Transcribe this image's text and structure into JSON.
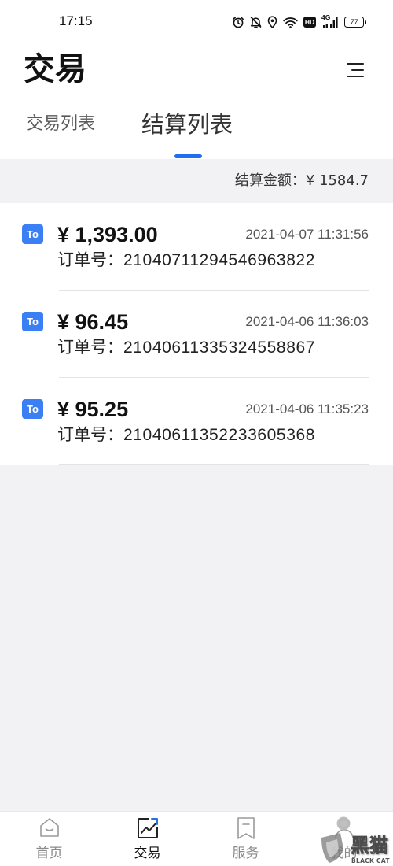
{
  "status_bar": {
    "time": "17:15",
    "icons": [
      "alarm-clock-icon",
      "bell-off-icon",
      "location-icon",
      "wifi-icon",
      "hd-badge",
      "signal-icon",
      "battery-icon"
    ],
    "hd_label": "HD",
    "network_label": "4G",
    "battery_level": "77"
  },
  "header": {
    "title": "交易",
    "menu_icon": "menu-icon"
  },
  "tabs": [
    {
      "label": "交易列表",
      "active": false
    },
    {
      "label": "结算列表",
      "active": true
    }
  ],
  "summary": {
    "label": "结算金额：",
    "amount": "¥ 1584.7"
  },
  "settlements": [
    {
      "badge": "To",
      "amount": "¥ 1,393.00",
      "datetime": "2021-04-07 11:31:56",
      "order_label": "订单号：",
      "order_no": "21040711294546963822"
    },
    {
      "badge": "To",
      "amount": "¥ 96.45",
      "datetime": "2021-04-06 11:36:03",
      "order_label": "订单号：",
      "order_no": "21040611335324558867"
    },
    {
      "badge": "To",
      "amount": "¥ 95.25",
      "datetime": "2021-04-06 11:35:23",
      "order_label": "订单号：",
      "order_no": "21040611352233605368"
    }
  ],
  "bottom_nav": [
    {
      "label": "首页",
      "icon": "home-icon",
      "active": false
    },
    {
      "label": "交易",
      "icon": "trend-chart-icon",
      "active": true
    },
    {
      "label": "服务",
      "icon": "bookmark-icon",
      "active": false
    },
    {
      "label": "我的",
      "icon": "user-icon",
      "active": false
    }
  ],
  "watermark": {
    "text": "黑猫",
    "subtext": "BLACK CAT"
  },
  "colors": {
    "accent": "#1f6fef",
    "badge": "#3b7ff4",
    "page_background": "#f2f2f4",
    "card_background": "#ffffff",
    "active_text": "#111111",
    "inactive_text": "#8a8a8a"
  }
}
